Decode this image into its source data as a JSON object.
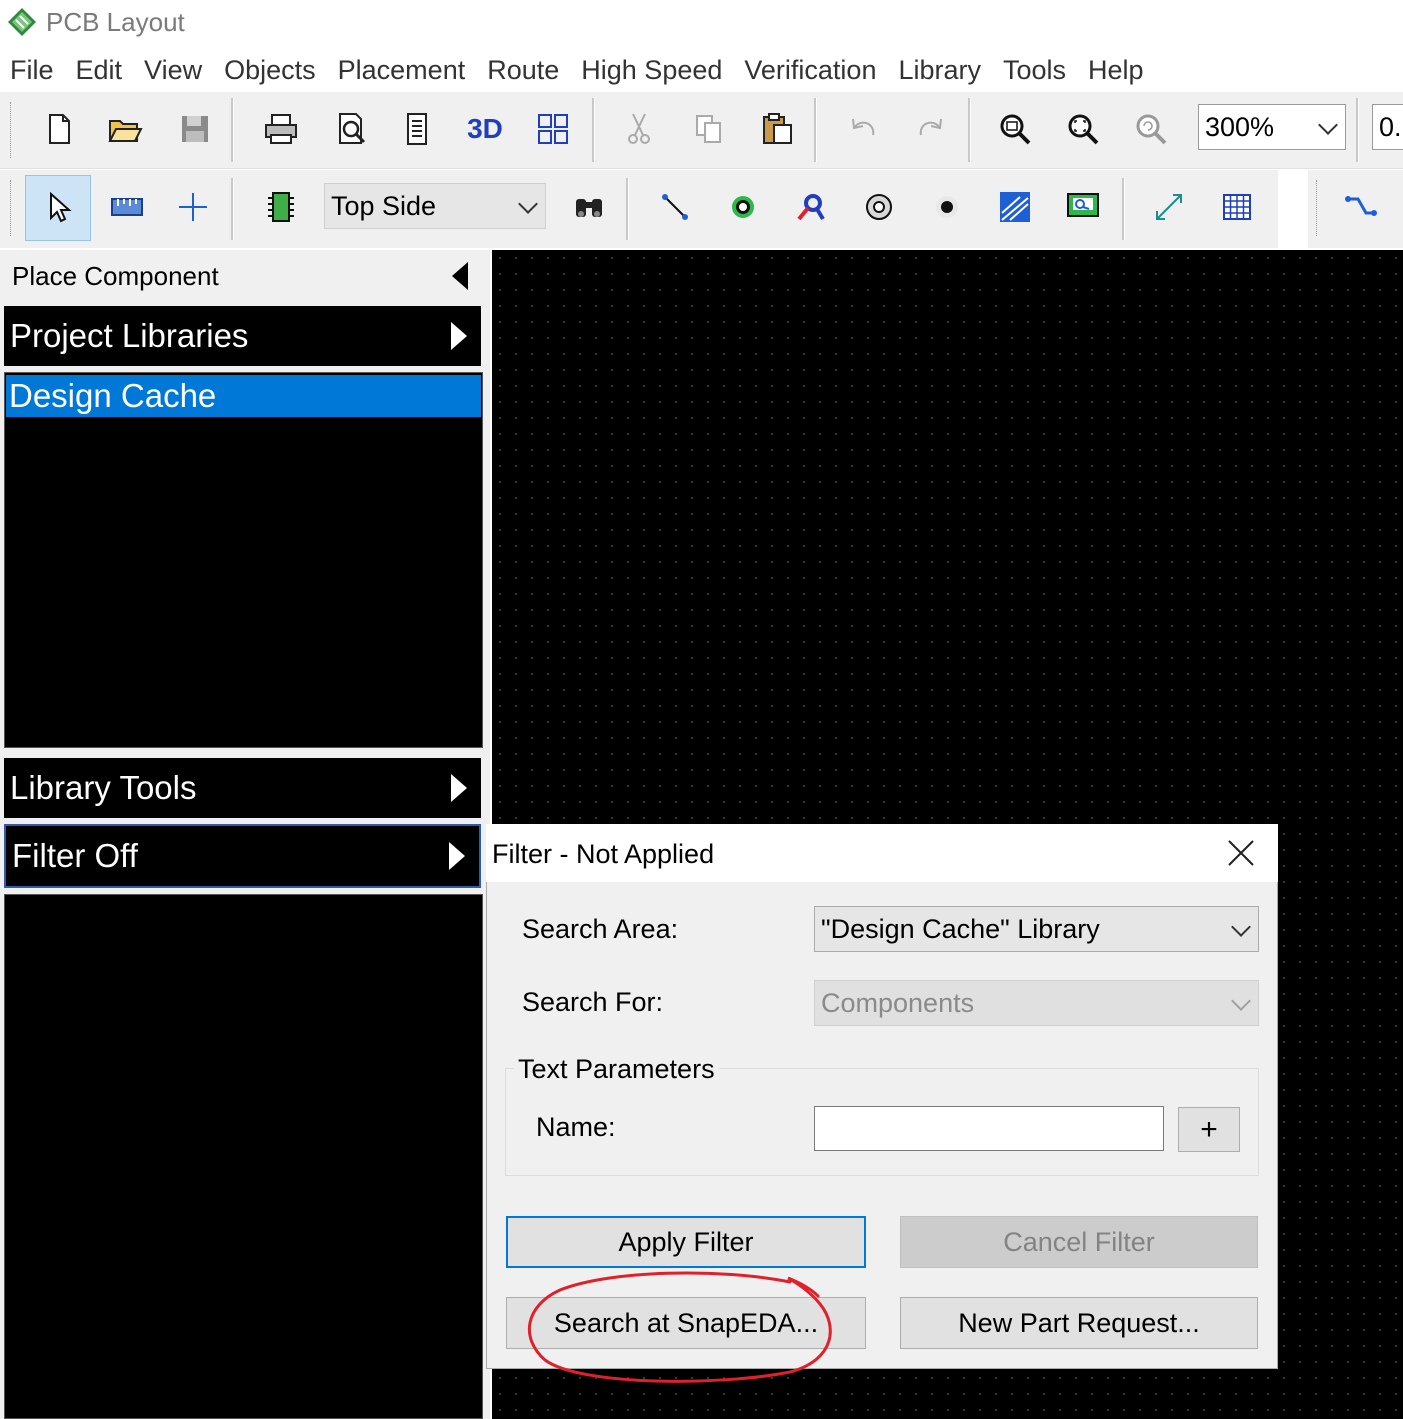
{
  "window": {
    "title": "PCB Layout",
    "logo_icon": "pcb-layout-logo-icon"
  },
  "menu": [
    "File",
    "Edit",
    "View",
    "Objects",
    "Placement",
    "Route",
    "High Speed",
    "Verification",
    "Library",
    "Tools",
    "Help"
  ],
  "toolbar1": {
    "icons": [
      "new-file-icon",
      "open-folder-icon",
      "save-icon",
      "print-icon",
      "print-preview-icon",
      "report-icon",
      "3d-view-icon",
      "layout-grid-icon",
      "cut-icon",
      "copy-icon",
      "paste-icon",
      "undo-icon",
      "redo-icon",
      "zoom-in-icon",
      "zoom-fit-icon",
      "zoom-previous-icon"
    ],
    "label_3d": "3D",
    "zoom_value": "300%",
    "extra_value": "0."
  },
  "toolbar2": {
    "side_value": "Top Side",
    "icons": [
      "select-arrow-icon",
      "measure-ruler-icon",
      "crosshair-icon",
      "component-chip-icon",
      "binoculars-icon",
      "trace-icon",
      "pad-icon",
      "via-search-icon",
      "ring-icon",
      "filled-dot-icon",
      "copper-pour-icon",
      "board-outline-icon",
      "dimension-icon",
      "table-grid-icon",
      "route-icon"
    ]
  },
  "left_panel": {
    "title": "Place Component",
    "sections": {
      "project_libraries": "Project Libraries",
      "design_cache": "Design Cache",
      "library_tools": "Library Tools",
      "filter": "Filter Off"
    }
  },
  "dialog": {
    "title": "Filter - Not Applied",
    "search_area_label": "Search Area:",
    "search_area_value": "\"Design Cache\" Library",
    "search_for_label": "Search For:",
    "search_for_value": "Components",
    "text_parameters_label": "Text Parameters",
    "name_label": "Name:",
    "name_value": "",
    "plus_label": "+",
    "apply_label": "Apply Filter",
    "cancel_label": "Cancel Filter",
    "snapeda_label": "Search at SnapEDA...",
    "new_part_label": "New Part Request..."
  },
  "colors": {
    "selection": "#0078d7",
    "annotation": "#e0202a",
    "canvas": "#000000"
  }
}
